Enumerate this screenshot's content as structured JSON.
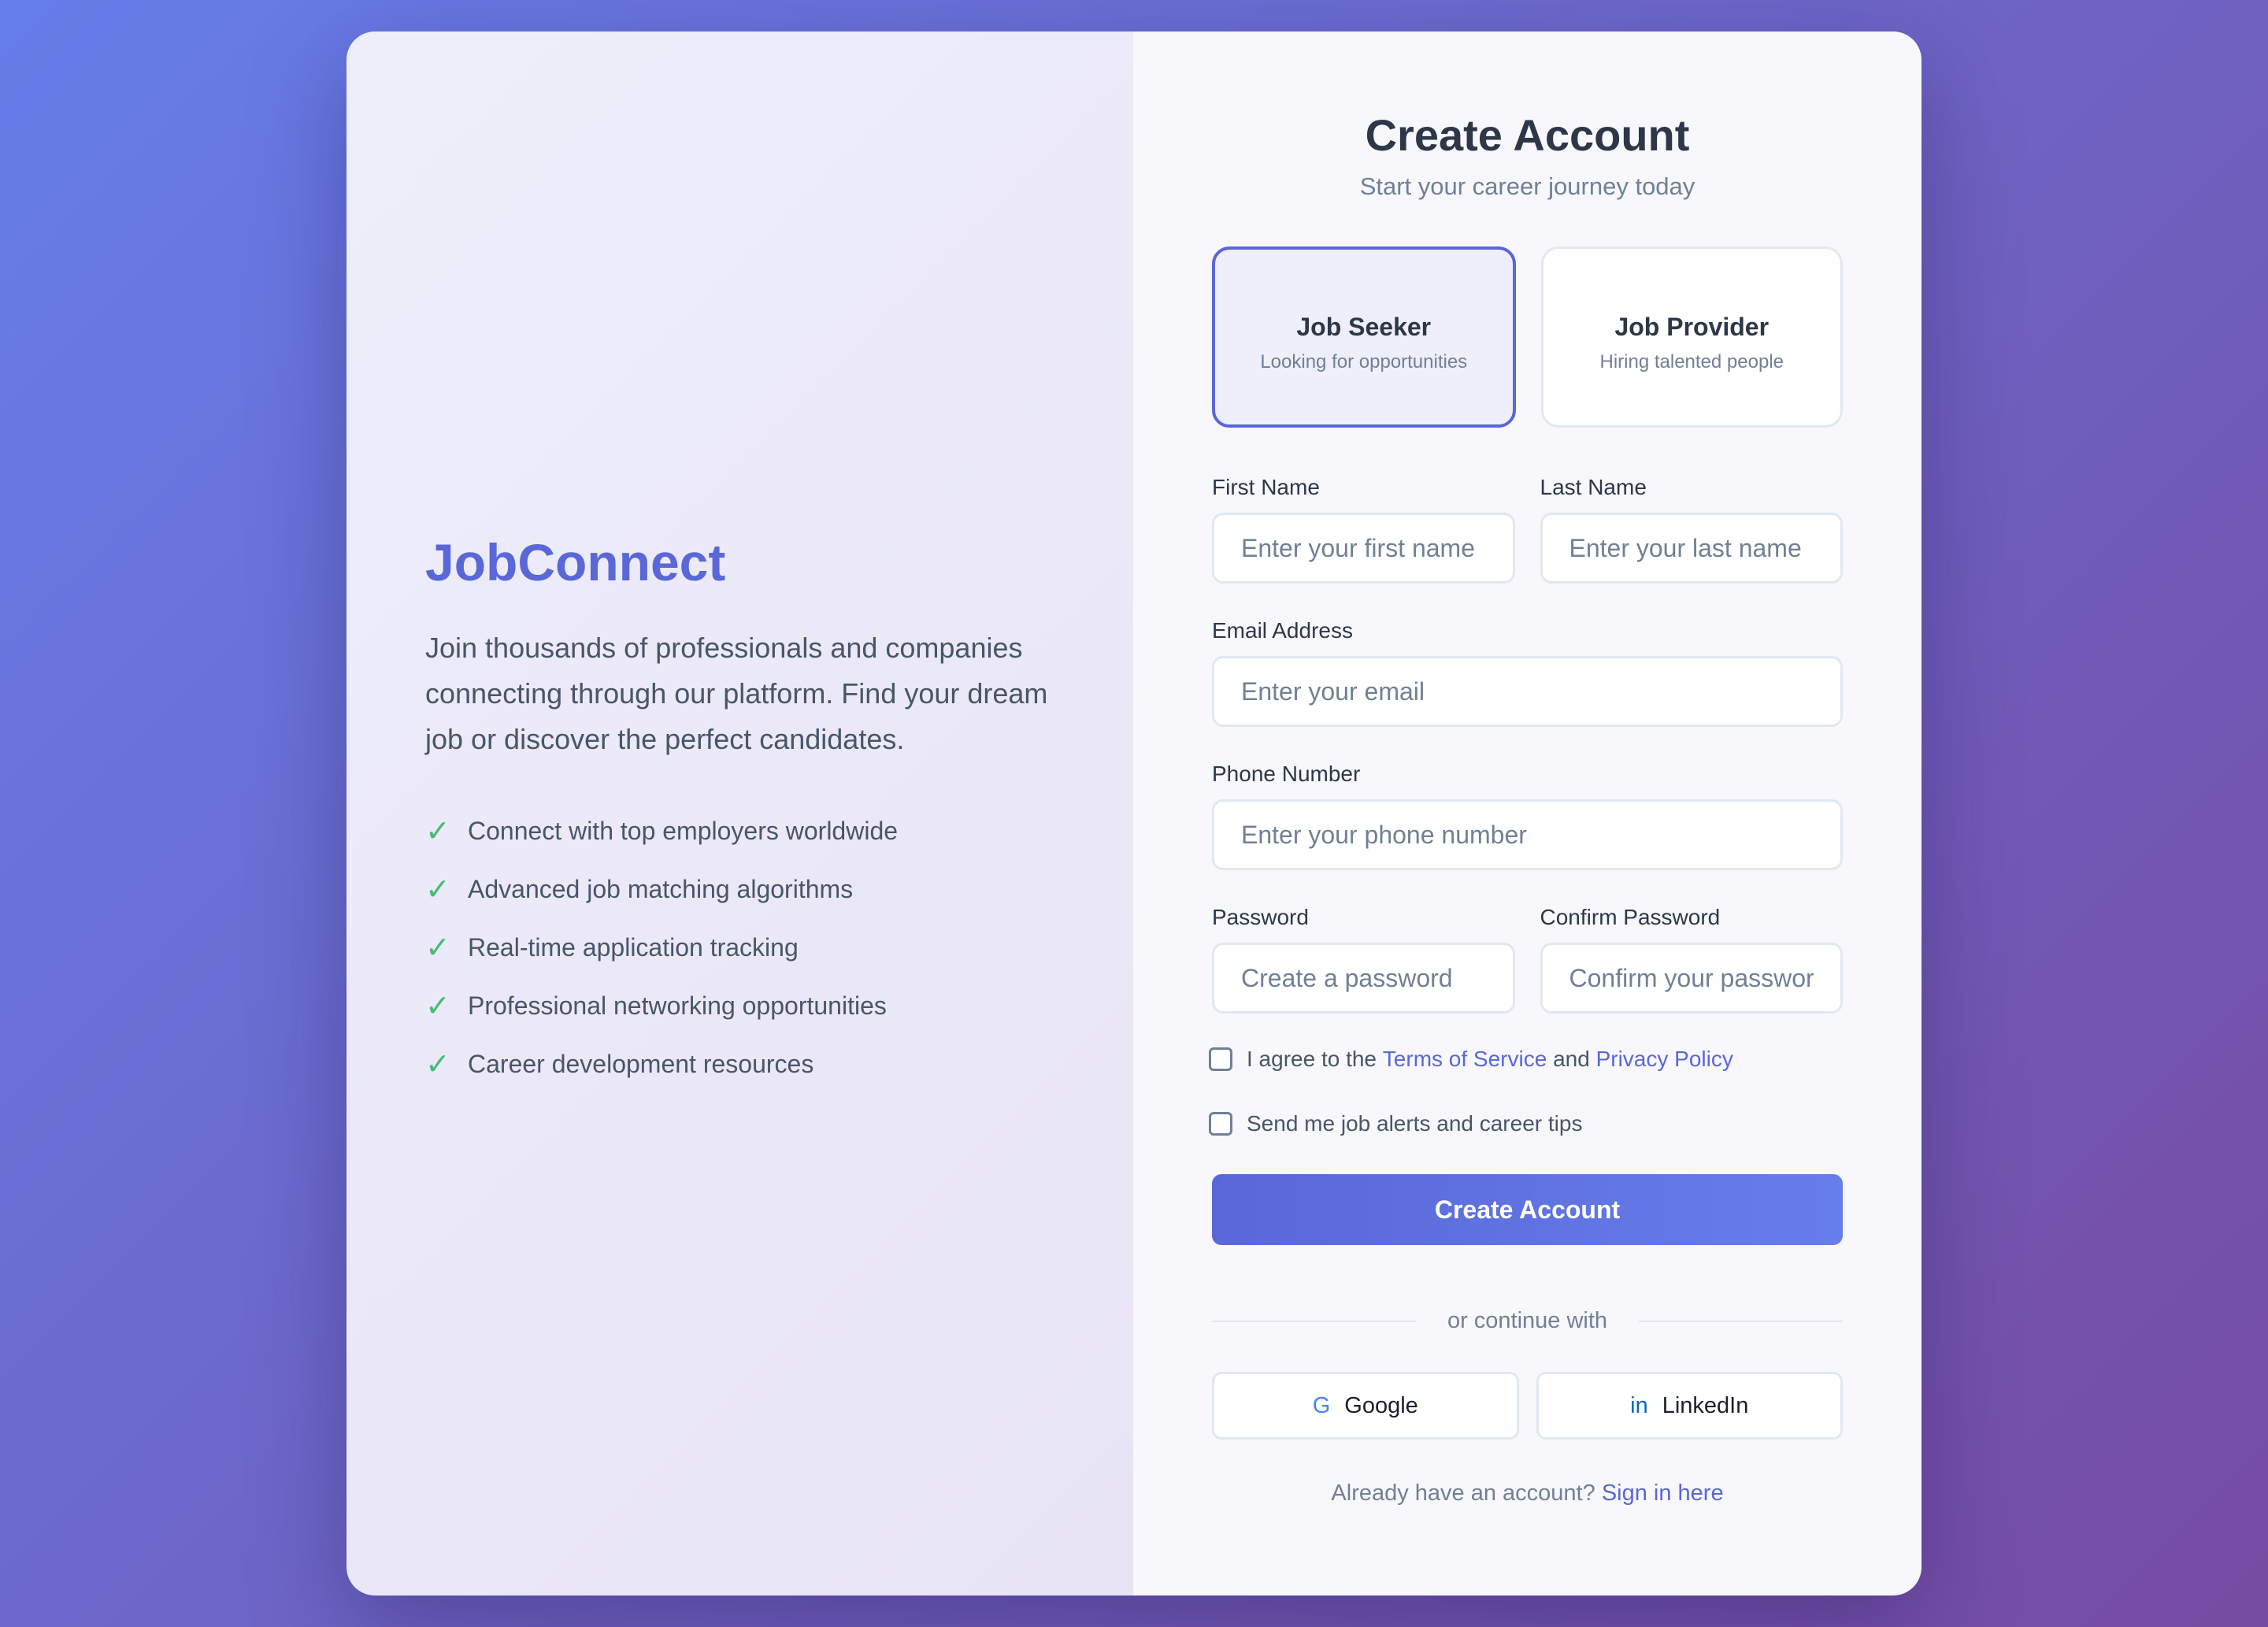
{
  "brand": {
    "name": "JobConnect",
    "description": "Join thousands of professionals and companies connecting through our platform. Find your dream job or discover the perfect candidates.",
    "check_symbol": "✓",
    "features": [
      "Connect with top employers worldwide",
      "Advanced job matching algorithms",
      "Real-time application tracking",
      "Professional networking opportunities",
      "Career development resources"
    ]
  },
  "form": {
    "title": "Create Account",
    "subtitle": "Start your career journey today",
    "roles": [
      {
        "icon": "briefcase-icon",
        "glyph": "",
        "title": "Job Seeker",
        "desc": "Looking for opportunities",
        "selected": true
      },
      {
        "icon": "building-icon",
        "glyph": "",
        "title": "Job Provider",
        "desc": "Hiring talented people",
        "selected": false
      }
    ],
    "first_name": {
      "label": "First Name",
      "placeholder": "Enter your first name"
    },
    "last_name": {
      "label": "Last Name",
      "placeholder": "Enter your last name"
    },
    "email": {
      "label": "Email Address",
      "placeholder": "Enter your email"
    },
    "phone": {
      "label": "Phone Number",
      "placeholder": "Enter your phone number"
    },
    "password": {
      "label": "Password",
      "placeholder": "Create a password"
    },
    "confirm_password": {
      "label": "Confirm Password",
      "placeholder": "Confirm your password"
    },
    "terms": {
      "prefix": "I agree to the",
      "terms_link": "Terms of Service",
      "middle": "and",
      "privacy_link": "Privacy Policy",
      "checked": false
    },
    "alerts": {
      "label": "Send me job alerts and career tips",
      "checked": false
    },
    "submit_label": "Create Account",
    "divider_text": "or continue with",
    "social": [
      {
        "icon": "google-icon",
        "glyph": "G",
        "label": "Google"
      },
      {
        "icon": "linkedin-icon",
        "glyph": "in",
        "label": "LinkedIn"
      }
    ],
    "signin_prompt": "Already have an account?",
    "signin_link": "Sign in here"
  },
  "colors": {
    "accent": "#5a67d8",
    "check": "#48bb78",
    "google": "#4285f4",
    "linkedin": "#0a66c2"
  }
}
